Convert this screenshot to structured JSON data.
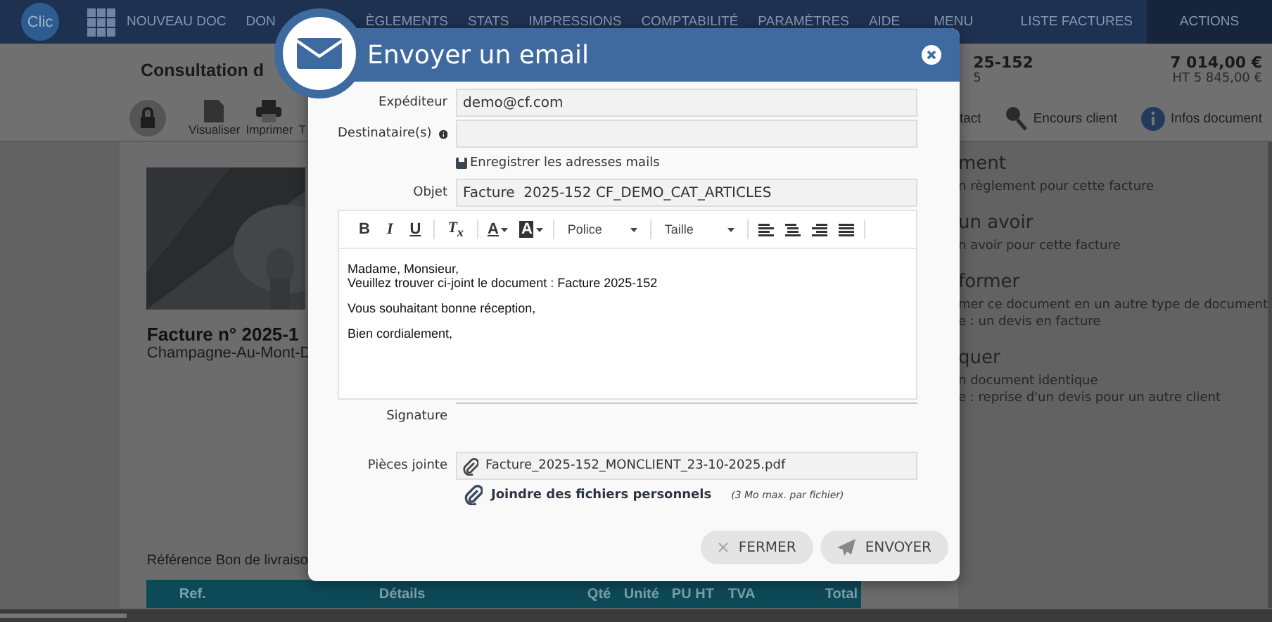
{
  "nav": {
    "logo": "Clic",
    "items": [
      "NOUVEAU DOC",
      "DON",
      "ÈGLEMENTS",
      "STATS",
      "IMPRESSIONS",
      "COMPTABILITÉ",
      "PARAMÈTRES",
      "AIDE"
    ],
    "menu": "MENU",
    "list": "LISTE FACTURES",
    "actions": "ACTIONS"
  },
  "header": {
    "title": "Consultation d",
    "number": "25-152",
    "number_sub": "5",
    "total": "7 014,00 €",
    "total_ht": "HT 5 845,00 €"
  },
  "toolbar": {
    "left": [
      {
        "kind": "pdf",
        "label": "Visualiser"
      },
      {
        "kind": "print",
        "label": "Imprimer"
      },
      {
        "kind": "none",
        "label": "T"
      }
    ],
    "right": [
      {
        "kind": "none",
        "label": "tact"
      },
      {
        "kind": "search",
        "label": "Encours client"
      },
      {
        "kind": "info",
        "label": "Infos document"
      }
    ]
  },
  "document": {
    "title": "Facture n° 2025-1",
    "city": "Champagne-Au-Mont-D",
    "reference": "Référence Bon de livraiso",
    "columns": [
      "Ref.",
      "Détails",
      "Qté",
      "Unité",
      "PU HT",
      "TVA",
      "Total"
    ]
  },
  "actions_list": [
    {
      "title": "ment",
      "lines": [
        "n règlement pour cette facture"
      ]
    },
    {
      "title": "un avoir",
      "lines": [
        "n avoir pour cette facture"
      ]
    },
    {
      "title": "former",
      "lines": [
        "mer ce document en un autre type de document",
        "e : un devis en facture"
      ]
    },
    {
      "title": "quer",
      "lines": [
        "n document identique",
        "e : reprise d'un devis pour un autre client"
      ]
    }
  ],
  "modal": {
    "title": "Envoyer un email",
    "sender_label": "Expéditeur",
    "sender": "demo@cf.com",
    "recipients_label": "Destinataire(s)",
    "save_link": "Enregistrer les adresses mails",
    "subject_label": "Objet",
    "subject": "Facture  2025-152 CF_DEMO_CAT_ARTICLES",
    "editor_toolbar": {
      "bold": "B",
      "italic": "I",
      "underline": "U",
      "clear": "T$_{x}$",
      "font_color": "A",
      "bg_color": "A",
      "font": "Police",
      "size": "Taille"
    },
    "body": [
      "Madame, Monsieur,\nVeuillez trouver ci-joint le document : Facture 2025-152",
      "Vous souhaitant bonne réception,",
      "Bien cordialement,"
    ],
    "signature_label": "Signature",
    "attachments_label": "Pièces jointe",
    "attachment": "Facture_2025-152_MONCLIENT_23-10-2025.pdf",
    "attach_link": "Joindre des fichiers personnels",
    "attach_note": "(3 Mo max. par fichier)",
    "close_button": "FERMER",
    "send_button": "ENVOYER"
  }
}
